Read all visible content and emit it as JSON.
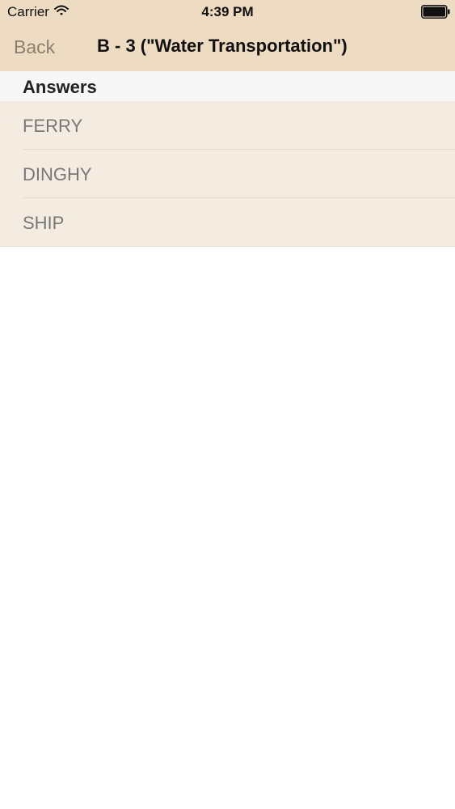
{
  "status_bar": {
    "carrier": "Carrier",
    "time": "4:39 PM"
  },
  "nav": {
    "back_label": "Back",
    "title": "B - 3 (\"Water Transportation\")"
  },
  "section": {
    "title": "Answers"
  },
  "answers": [
    {
      "label": "FERRY"
    },
    {
      "label": "DINGHY"
    },
    {
      "label": "SHIP"
    }
  ],
  "colors": {
    "nav_background": "#eedcc2",
    "row_background": "#f5ece1",
    "section_background": "#f7f7f7",
    "back_text": "#8a8070",
    "row_text": "#777777"
  },
  "icons": {
    "wifi": "wifi-icon",
    "battery": "battery-icon"
  }
}
